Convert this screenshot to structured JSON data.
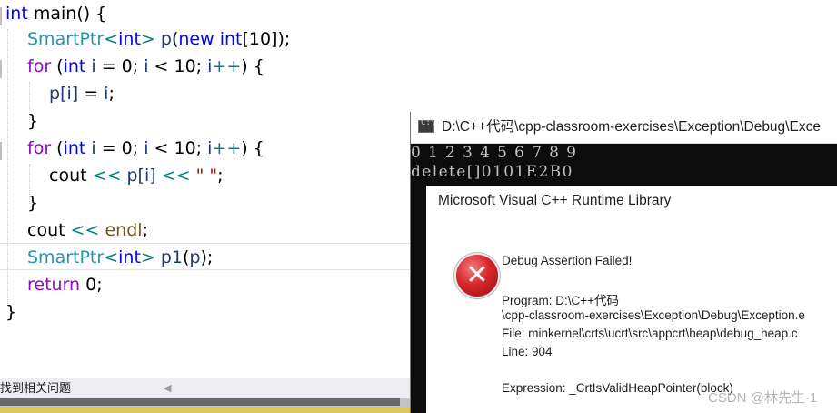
{
  "editor": {
    "lines": {
      "l1": {
        "kw": "int",
        "fn": "main",
        "rest": "() {"
      },
      "l2": {
        "ty": "SmartPtr",
        "op1": "<",
        "kw": "int",
        "op2": ">",
        "var": "p",
        "p1": "(",
        "kw2": "new",
        "kw3": "int",
        "rest": "[10]);"
      },
      "l3": {
        "kw2": "for",
        "p1": " (",
        "kw": "int",
        "var": "i",
        "rest": " = 0; ",
        "var2": "i",
        "rest2": " < 10; ",
        "var3": "i",
        "op": "++",
        "rest3": ") {"
      },
      "l4": {
        "var": "p",
        "op": "[i]",
        "rest": " = ",
        "var2": "i",
        "rest2": ";"
      },
      "l5": {
        "rest": "}"
      },
      "l6": {
        "kw2": "for",
        "p1": " (",
        "kw": "int",
        "var": "i",
        "rest": " = 0; ",
        "var2": "i",
        "rest2": " < 10; ",
        "var3": "i",
        "op": "++",
        "rest3": ") {"
      },
      "l7": {
        "id": "cout",
        "op1": " << ",
        "var": "p",
        "op2": "[i]",
        "op3": " << ",
        "st": "\" \"",
        "rest": ";"
      },
      "l8": {
        "rest": "}"
      },
      "l9": {
        "id": "cout",
        "op1": " << ",
        "fn": "endl",
        "rest": ";"
      },
      "l10": {
        "ty": "SmartPtr",
        "op1": "<",
        "kw": "int",
        "op2": ">",
        "var": "p1",
        "rest": "(",
        "var2": "p",
        "rest2": ");"
      },
      "l11": {
        "kw2": "return",
        "rest": " 0;"
      },
      "l12": {
        "rest": "}"
      }
    }
  },
  "statusbar": {
    "issues_label": "找到相关问题",
    "arrow": "◀"
  },
  "console": {
    "title": "D:\\C++代码\\cpp-classroom-exercises\\Exception\\Debug\\Exce",
    "output_line1": "0 1 2 3 4 5 6 7 8 9",
    "output_line2": "delete[]0101E2B0"
  },
  "dialog": {
    "title": "Microsoft Visual C++ Runtime Library",
    "heading": "Debug Assertion Failed!",
    "program_line1": "Program: D:\\C++代码",
    "program_line2": "\\cpp-classroom-exercises\\Exception\\Debug\\Exception.e",
    "file_line": "File: minkernel\\crts\\ucrt\\src\\appcrt\\heap\\debug_heap.c",
    "line_line": "Line: 904",
    "expression_line": "Expression: _CrtIsValidHeapPointer(block)"
  },
  "watermark": "CSDN @林先生-1",
  "colors": {
    "keyword": "#0000ff",
    "control": "#8f08c4",
    "type": "#2b91af",
    "variable": "#1f377f",
    "operator": "#008080",
    "string": "#a31515",
    "error_red": "#d6262b",
    "console_bg": "#0c0c0c"
  }
}
